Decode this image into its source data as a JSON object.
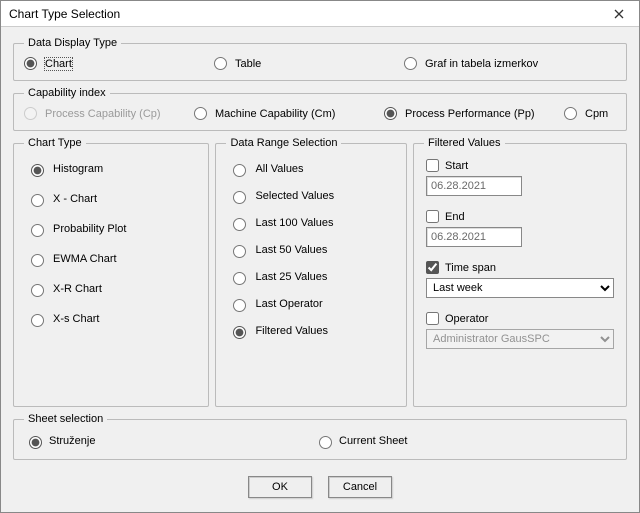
{
  "window": {
    "title": "Chart Type Selection"
  },
  "dataDisplayType": {
    "legend": "Data Display Type",
    "options": [
      "Chart",
      "Table",
      "Graf in tabela izmerkov"
    ],
    "selected": "Chart"
  },
  "capabilityIndex": {
    "legend": "Capability index",
    "options": [
      {
        "label": "Process Capability (Cp)",
        "disabled": true
      },
      {
        "label": "Machine Capability (Cm)",
        "disabled": false
      },
      {
        "label": "Process Performance (Pp)",
        "disabled": false
      },
      {
        "label": "Cpm",
        "disabled": false
      }
    ],
    "selected": "Process Performance (Pp)"
  },
  "chartType": {
    "legend": "Chart Type",
    "options": [
      "Histogram",
      "X - Chart",
      "Probability Plot",
      "EWMA Chart",
      "X-R Chart",
      "X-s Chart"
    ],
    "selected": "Histogram"
  },
  "dataRange": {
    "legend": "Data Range Selection",
    "options": [
      "All Values",
      "Selected Values",
      "Last 100 Values",
      "Last 50 Values",
      "Last 25 Values",
      "Last Operator",
      "Filtered Values"
    ],
    "selected": "Filtered Values"
  },
  "filtered": {
    "legend": "Filtered Values",
    "start": {
      "label": "Start",
      "checked": false,
      "value": "06.28.2021"
    },
    "end": {
      "label": "End",
      "checked": false,
      "value": "06.28.2021"
    },
    "timespan": {
      "label": "Time span",
      "checked": true,
      "value": "Last week",
      "options": [
        "Last week"
      ]
    },
    "operator": {
      "label": "Operator",
      "checked": false,
      "value": "Administrator GausSPC",
      "options": [
        "Administrator GausSPC"
      ]
    }
  },
  "sheetSelection": {
    "legend": "Sheet selection",
    "options": [
      "Struženje",
      "Current Sheet"
    ],
    "selected": "Struženje"
  },
  "buttons": {
    "ok": "OK",
    "cancel": "Cancel"
  }
}
